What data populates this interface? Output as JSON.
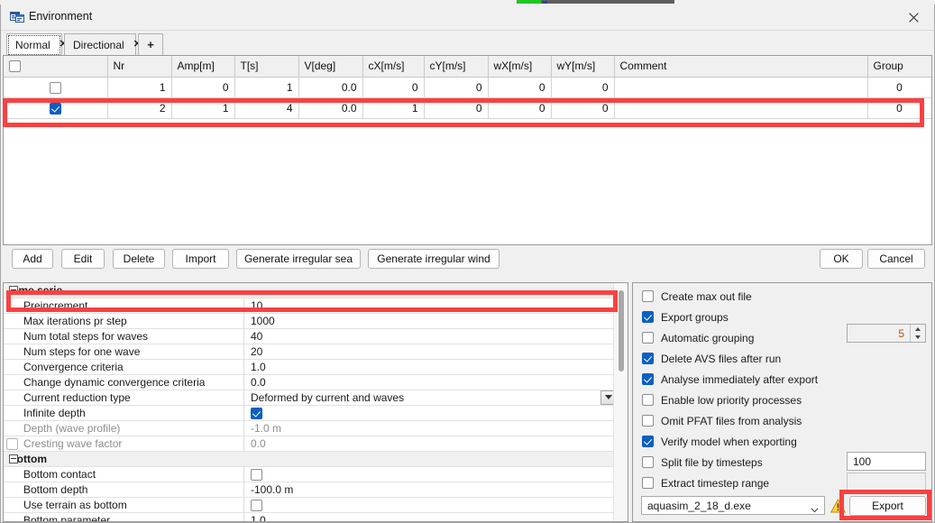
{
  "window": {
    "title": "Environment",
    "icon": "app-window-icon",
    "close_label": "✕"
  },
  "tabs": {
    "items": [
      {
        "label": "Normal",
        "close": "✕",
        "active": true
      },
      {
        "label": "Directional",
        "close": "✕",
        "active": false
      }
    ],
    "add_label": "+"
  },
  "table": {
    "columns": [
      {
        "key": "sel",
        "label": "",
        "align": "ctr"
      },
      {
        "key": "nr",
        "label": "Nr",
        "align": "num"
      },
      {
        "key": "amp",
        "label": "Amp[m]",
        "align": "num"
      },
      {
        "key": "t",
        "label": "T[s]",
        "align": "num"
      },
      {
        "key": "v",
        "label": "V[deg]",
        "align": "num"
      },
      {
        "key": "cx",
        "label": "cX[m/s]",
        "align": "num"
      },
      {
        "key": "cy",
        "label": "cY[m/s]",
        "align": "num"
      },
      {
        "key": "wx",
        "label": "wX[m/s]",
        "align": "num"
      },
      {
        "key": "wy",
        "label": "wY[m/s]",
        "align": "num"
      },
      {
        "key": "comment",
        "label": "Comment",
        "align": "left"
      },
      {
        "key": "group",
        "label": "Group",
        "align": "ctr"
      }
    ],
    "header_checkbox_checked": false,
    "rows": [
      {
        "selected": false,
        "highlighted": false,
        "nr": "1",
        "amp": "0",
        "t": "1",
        "v": "0.0",
        "cx": "0",
        "cy": "0",
        "wx": "0",
        "wy": "0",
        "comment": "",
        "group": "0"
      },
      {
        "selected": true,
        "highlighted": true,
        "nr": "2",
        "amp": "1",
        "t": "4",
        "v": "0.0",
        "cx": "1",
        "cy": "0",
        "wx": "0",
        "wy": "0",
        "comment": "",
        "group": "0"
      }
    ]
  },
  "toolbar": {
    "add": "Add",
    "edit": "Edit",
    "delete": "Delete",
    "import": "Import",
    "gen_sea": "Generate irregular sea",
    "gen_wind": "Generate irregular wind",
    "ok": "OK",
    "cancel": "Cancel"
  },
  "properties": {
    "rows": [
      {
        "type": "category",
        "label": "Time serie"
      },
      {
        "type": "text",
        "label": "Preincrement",
        "value": "10",
        "highlighted": true
      },
      {
        "type": "text",
        "label": "Max iterations pr step",
        "value": "1000"
      },
      {
        "type": "text",
        "label": "Num total steps for waves",
        "value": "40"
      },
      {
        "type": "text",
        "label": "Num steps for one wave",
        "value": "20"
      },
      {
        "type": "text",
        "label": "Convergence criteria",
        "value": "1.0"
      },
      {
        "type": "text",
        "label": "Change dynamic convergence criteria",
        "value": "0.0"
      },
      {
        "type": "combo",
        "label": "Current reduction type",
        "value": "Deformed by current and waves"
      },
      {
        "type": "check",
        "label": "Infinite depth",
        "checked": true
      },
      {
        "type": "text",
        "label": "Depth (wave profile)",
        "value": "-1.0 m",
        "disabled": true
      },
      {
        "type": "checklabel",
        "label": "Cresting wave factor",
        "value": "0.0",
        "labelChecked": false,
        "disabled": true
      },
      {
        "type": "category",
        "label": "Bottom"
      },
      {
        "type": "check",
        "label": "Bottom contact",
        "checked": false
      },
      {
        "type": "text",
        "label": "Bottom depth",
        "value": "-100.0 m"
      },
      {
        "type": "check",
        "label": "Use terrain as bottom",
        "checked": false
      },
      {
        "type": "text",
        "label": "Bottom parameter",
        "value": "1.0"
      }
    ]
  },
  "export_options": {
    "checks": [
      {
        "label": "Create max out file",
        "checked": false
      },
      {
        "label": "Export groups",
        "checked": true
      },
      {
        "label": "Automatic grouping",
        "checked": false
      },
      {
        "label": "Delete AVS files after run",
        "checked": true
      },
      {
        "label": "Analyse immediately after export",
        "checked": true
      },
      {
        "label": "Enable low priority processes",
        "checked": false
      },
      {
        "label": "Omit PFAT files from analysis",
        "checked": false
      },
      {
        "label": "Verify model when exporting",
        "checked": true
      },
      {
        "label": "Split file by timesteps",
        "checked": false
      },
      {
        "label": "Extract timestep range",
        "checked": false
      }
    ],
    "grouping_count": "5",
    "split_timesteps": "100",
    "timestep_range": "",
    "solver": "aquasim_2_18_d.exe",
    "warning_icon": "warning-triangle-icon",
    "export_label": "Export"
  },
  "colors": {
    "highlight_red": "#fb4040",
    "accent_blue": "#0a5fc2",
    "warning_amber": "#f0b429"
  }
}
